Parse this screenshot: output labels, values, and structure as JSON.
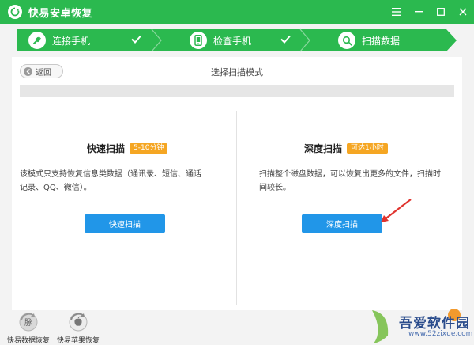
{
  "window": {
    "title": "快易安卓恢复"
  },
  "steps": [
    {
      "label": "连接手机",
      "status": "done",
      "icon": "usb-plug-icon"
    },
    {
      "label": "检查手机",
      "status": "done",
      "icon": "phone-icon"
    },
    {
      "label": "扫描数据",
      "status": "active",
      "icon": "search-icon"
    }
  ],
  "toolbar": {
    "back_label": "返回",
    "mode_title": "选择扫描模式"
  },
  "options": {
    "quick": {
      "title": "快速扫描",
      "badge": "5-10分钟",
      "desc_line1": "该模式只支持恢复信息类数据（通讯录、短信、通话",
      "desc_line2": "记录、QQ、微信）。",
      "button": "快速扫描"
    },
    "deep": {
      "title": "深度扫描",
      "badge": "可达1小时",
      "desc_line1": "扫描整个磁盘数据，可以恢复出更多的文件，扫描时",
      "desc_line2": "间较长。",
      "button": "深度扫描"
    }
  },
  "footer": {
    "android_label": "快易数据恢复",
    "apple_label": "快易苹果恢复",
    "android_icon_text": "脉"
  },
  "watermark": {
    "brand": "吾爱软件园",
    "url": "www.52zixue.com"
  },
  "colors": {
    "green": "#2bb94f",
    "green_dark": "#1e9e3e",
    "blue": "#2196e8",
    "orange": "#f5a623",
    "arrow_red": "#e0342f"
  }
}
